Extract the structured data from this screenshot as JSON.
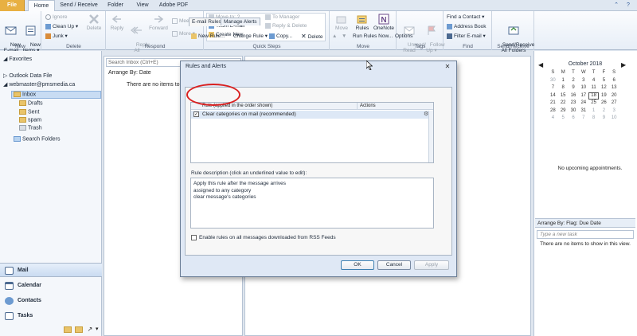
{
  "ribbon_tabs": [
    "File",
    "Home",
    "Send / Receive",
    "Folder",
    "View",
    "Adobe PDF"
  ],
  "ribbon": {
    "new": {
      "new_email": "New\nE-mail",
      "new_items": "New\nItems ▾",
      "label": "New"
    },
    "delete": {
      "ignore": "Ignore",
      "clean_up": "Clean Up ▾",
      "junk": "Junk ▾",
      "delete": "Delete",
      "label": "Delete"
    },
    "respond": {
      "reply": "Reply",
      "reply_all": "Reply\nAll",
      "forward": "Forward",
      "meeting": "Meeting",
      "more": "More ▾",
      "label": "Respond"
    },
    "quick_steps": {
      "move_to": "Move to: ?",
      "team_email": "Team E-mail",
      "create_new": "Create New",
      "to_manager": "To Manager",
      "reply_delete": "Reply & Delete",
      "label": "Quick Steps"
    },
    "move": {
      "move": "Move",
      "rules": "Rules",
      "onenote": "OneNote",
      "label": "Move"
    },
    "tags": {
      "unread_read": "Unread/\nRead",
      "follow_up": "Follow\nUp ▾",
      "label": "Tags"
    },
    "find": {
      "find_contact": "Find a Contact ▾",
      "address_book": "Address Book",
      "filter_email": "Filter E-mail ▾",
      "label": "Find"
    },
    "send_receive": {
      "all_folders": "Send/Receive\nAll Folders",
      "label": "Send/Receive"
    }
  },
  "leftnav": {
    "favorites": "◢ Favorites",
    "outlook_data_file": "▷ Outlook Data File",
    "account": "◢ webmaster@pmsmedia.ca",
    "folders": [
      "Inbox",
      "Drafts",
      "Sent",
      "spam",
      "Trash"
    ],
    "search_folders": "Search Folders",
    "bottom": [
      "Mail",
      "Calendar",
      "Contacts",
      "Tasks"
    ]
  },
  "msglist": {
    "search_placeholder": "Search Inbox (Ctrl+E)",
    "arrange": "Arrange By: Date",
    "empty": "There are no items to"
  },
  "todo": {
    "month": "October 2018",
    "weekdays": [
      "S",
      "M",
      "T",
      "W",
      "T",
      "F",
      "S"
    ],
    "weeks": [
      [
        "30",
        "1",
        "2",
        "3",
        "4",
        "5",
        "6"
      ],
      [
        "7",
        "8",
        "9",
        "10",
        "11",
        "12",
        "13"
      ],
      [
        "14",
        "15",
        "16",
        "17",
        "18",
        "19",
        "20"
      ],
      [
        "21",
        "22",
        "23",
        "24",
        "25",
        "26",
        "27"
      ],
      [
        "28",
        "29",
        "30",
        "31",
        "1",
        "2",
        "3"
      ],
      [
        "4",
        "5",
        "6",
        "7",
        "8",
        "9",
        "10"
      ]
    ],
    "today": "18",
    "appointments": "No upcoming appointments.",
    "arrange": "Arrange By: Flag: Due Date",
    "new_task_placeholder": "Type a new task",
    "empty": "There are no items to show in this view."
  },
  "dialog": {
    "title": "Rules and Alerts",
    "tabs": [
      "E-mail Rules",
      "Manage Alerts"
    ],
    "toolbar": {
      "new_rule": "New Rule...",
      "change_rule": "Change Rule ▾",
      "copy": "Copy...",
      "delete": "Delete",
      "run_rules": "Run Rules Now...",
      "options": "Options"
    },
    "columns": {
      "rule": "Rule (applied in the order shown)",
      "actions": "Actions"
    },
    "rule": "Clear categories on mail (recommended)",
    "description_label": "Rule description (click an underlined value to edit):",
    "description_lines": [
      "Apply this rule after the message arrives",
      "assigned to any category",
      "clear message's categories"
    ],
    "rss": "Enable rules on all messages downloaded from RSS Feeds",
    "buttons": {
      "ok": "OK",
      "cancel": "Cancel",
      "apply": "Apply"
    }
  },
  "colors": {
    "highlight": "#d92020",
    "file_tab": "#e8b042",
    "accent": "#2b5797"
  }
}
